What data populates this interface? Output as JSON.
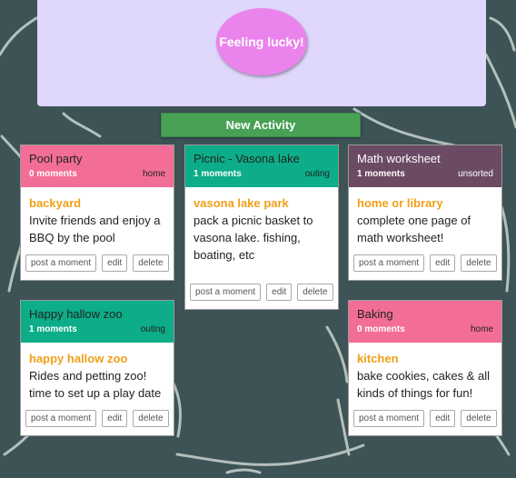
{
  "lucky_button": "Feeling lucky!",
  "new_activity_button": "New Activity",
  "action_labels": {
    "post": "post a moment",
    "edit": "edit",
    "delete": "delete"
  },
  "cards": [
    {
      "title": "Pool party",
      "moments": "0 moments",
      "category": "home",
      "location": "backyard",
      "description": "Invite friends and enjoy a BBQ by the pool",
      "header_color": "#f36e96"
    },
    {
      "title": "Picnic - Vasona lake",
      "moments": "1 moments",
      "category": "outing",
      "location": "vasona lake park",
      "description": "pack a picnic basket to vasona lake. fishing, boating, etc",
      "header_color": "#0cad88"
    },
    {
      "title": "Math worksheet",
      "moments": "1 moments",
      "category": "unsorted",
      "location": "home or library",
      "description": "complete one page of math worksheet!",
      "header_color": "#6b4a64"
    },
    {
      "title": "Happy hallow zoo",
      "moments": "1 moments",
      "category": "outing",
      "location": "happy hallow zoo",
      "description": "Rides and petting zoo! time to set up a play date",
      "header_color": "#0cad88"
    },
    {
      "title": "Baking",
      "moments": "0 moments",
      "category": "home",
      "location": "kitchen",
      "description": "bake cookies, cakes & all kinds of things for fun!",
      "header_color": "#f36e96"
    }
  ]
}
